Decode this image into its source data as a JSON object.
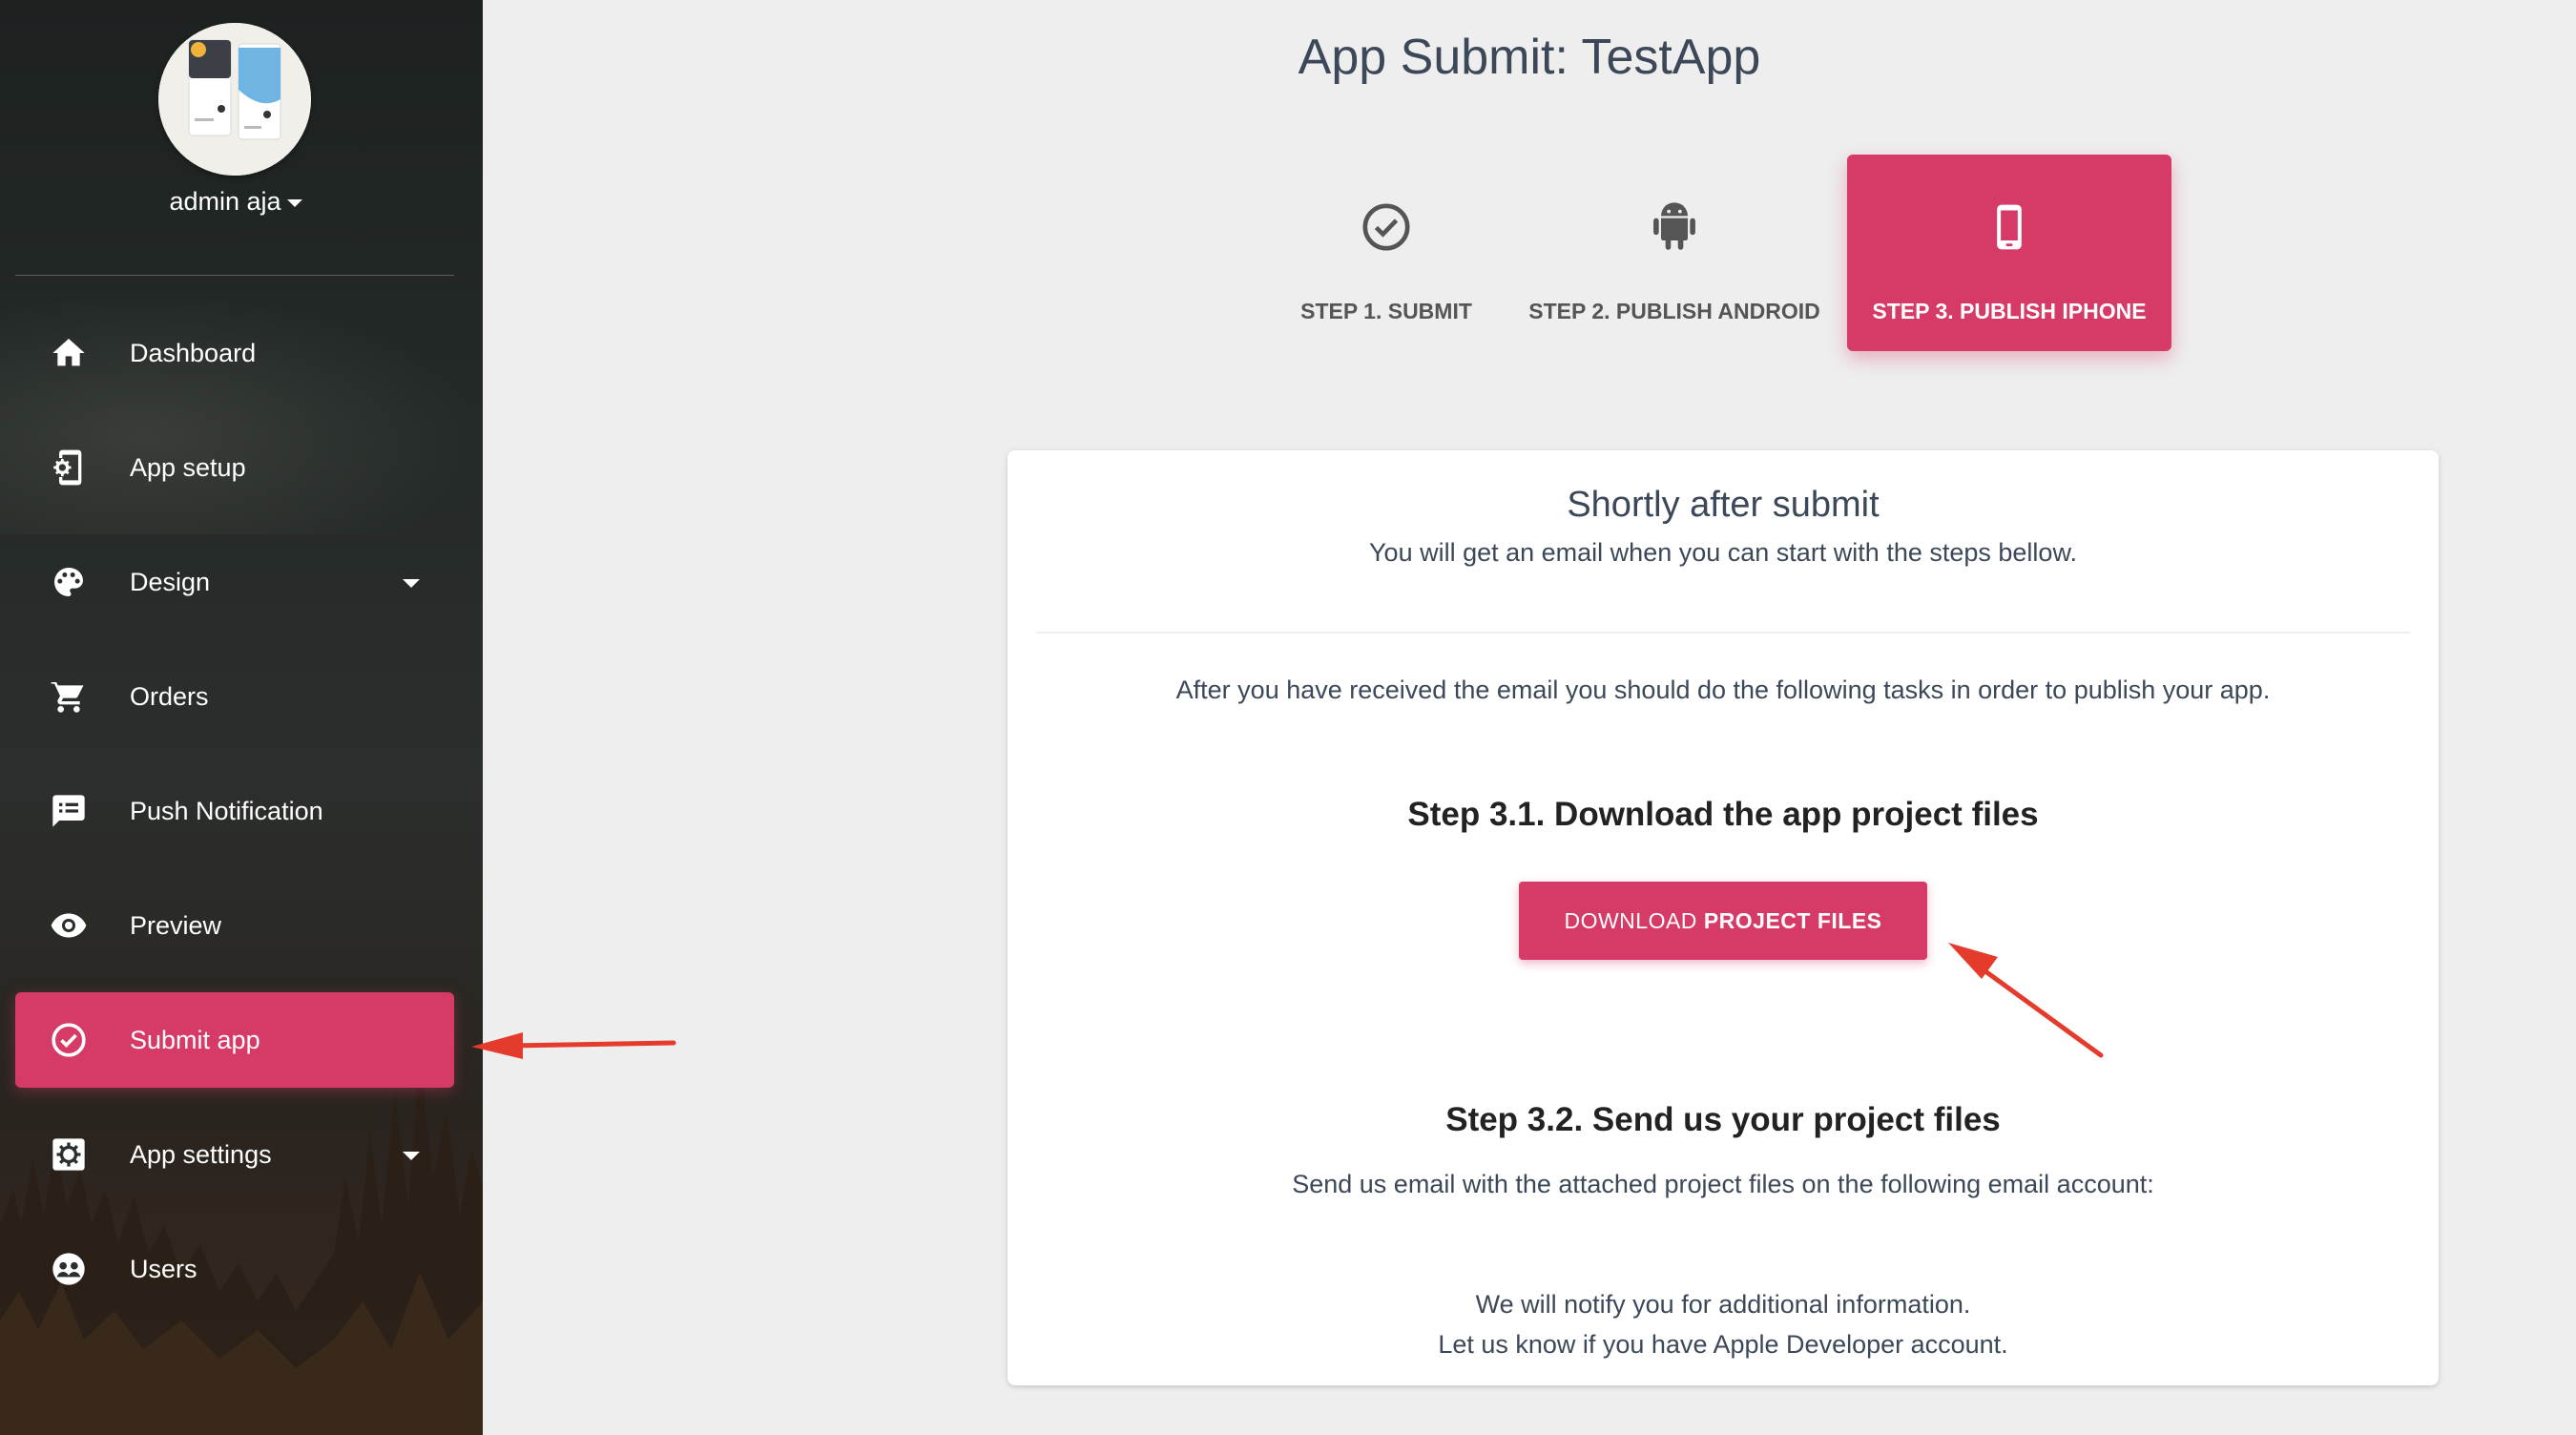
{
  "sidebar": {
    "user_name": "admin aja",
    "items": [
      {
        "label": "Dashboard",
        "icon": "home-icon",
        "has_caret": false,
        "active": false
      },
      {
        "label": "App setup",
        "icon": "phone-settings-icon",
        "has_caret": false,
        "active": false
      },
      {
        "label": "Design",
        "icon": "palette-icon",
        "has_caret": true,
        "active": false
      },
      {
        "label": "Orders",
        "icon": "cart-icon",
        "has_caret": false,
        "active": false
      },
      {
        "label": "Push Notification",
        "icon": "message-icon",
        "has_caret": false,
        "active": false
      },
      {
        "label": "Preview",
        "icon": "eye-icon",
        "has_caret": false,
        "active": false
      },
      {
        "label": "Submit app",
        "icon": "check-circle-icon",
        "has_caret": false,
        "active": true
      },
      {
        "label": "App settings",
        "icon": "gear-icon",
        "has_caret": true,
        "active": false
      },
      {
        "label": "Users",
        "icon": "users-icon",
        "has_caret": false,
        "active": false
      }
    ]
  },
  "main": {
    "title": "App Submit: TestApp",
    "steps": [
      {
        "label": "STEP 1. SUBMIT",
        "icon": "check-circle-icon",
        "active": false
      },
      {
        "label": "STEP 2. PUBLISH ANDROID",
        "icon": "android-icon",
        "active": false
      },
      {
        "label": "STEP 3. PUBLISH IPHONE",
        "icon": "phone-icon",
        "active": true
      }
    ],
    "card": {
      "title": "Shortly after submit",
      "subtitle": "You will get an email when you can start with the steps bellow.",
      "intro": "After you have received the email you should do the following tasks in order to publish your app.",
      "step1_heading": "Step 3.1. Download the app project files",
      "download_button_prefix": "DOWNLOAD ",
      "download_button_bold": "PROJECT FILES",
      "step2_heading": "Step 3.2. Send us your project files",
      "step2_text": "Send us email with the attached project files on the following email account:",
      "notify_line1": "We will notify you for additional information.",
      "notify_line2": "Let us know if you have Apple Developer account."
    }
  },
  "colors": {
    "accent": "#d63a66",
    "annotation_arrow": "#e53b2c",
    "page_background": "#eeeeee",
    "title_text": "#3c4858"
  }
}
